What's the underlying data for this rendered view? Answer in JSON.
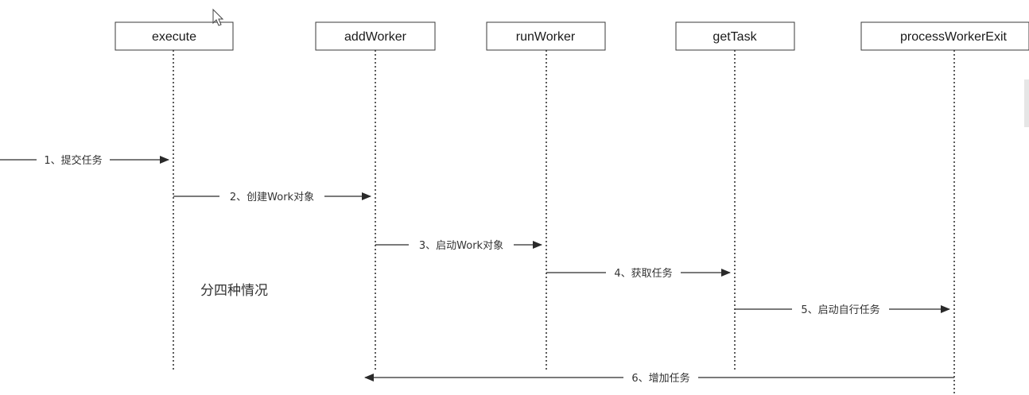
{
  "participants": [
    {
      "id": "execute",
      "label": "execute"
    },
    {
      "id": "addWorker",
      "label": "addWorker"
    },
    {
      "id": "runWorker",
      "label": "runWorker"
    },
    {
      "id": "getTask",
      "label": "getTask"
    },
    {
      "id": "processWorkerExit",
      "label": "processWorkerExit"
    }
  ],
  "messages": [
    {
      "label": "1、提交任务",
      "from": null,
      "to": "execute"
    },
    {
      "label": "2、创建Work对象",
      "from": "execute",
      "to": "addWorker"
    },
    {
      "label": "3、启动Work对象",
      "from": "addWorker",
      "to": "runWorker"
    },
    {
      "label": "4、获取任务",
      "from": "runWorker",
      "to": "getTask"
    },
    {
      "label": "5、启动自行任务",
      "from": "getTask",
      "to": "processWorkerExit"
    },
    {
      "label": "6、增加任务",
      "from": "processWorkerExit",
      "to": "addWorker"
    }
  ],
  "note": {
    "text": "分四种情况"
  },
  "icons": {
    "cursor": "mouse-pointer-icon"
  }
}
